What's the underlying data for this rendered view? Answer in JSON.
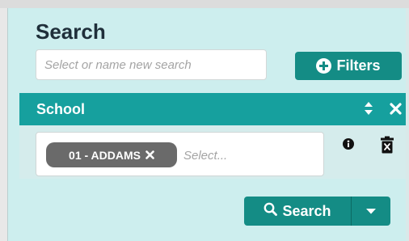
{
  "panel": {
    "title": "Search",
    "name_input": {
      "placeholder": "Select or name new search",
      "value": ""
    },
    "filters_button": {
      "label": "Filters",
      "icon": "plus-circle-icon"
    }
  },
  "filter": {
    "title": "School",
    "tags": [
      {
        "label": "01 - ADDAMS",
        "remove_icon": "times-icon"
      }
    ],
    "tag_input_placeholder": "Select...",
    "icons": [
      "sort-icon",
      "close-icon",
      "info-icon",
      "trash-icon"
    ]
  },
  "search_button": {
    "label": "Search",
    "icon": "search-icon",
    "dropdown_icon": "caret-down-icon"
  },
  "colors": {
    "panel_background": "#cdeeee",
    "accent": "#148c85",
    "filter_header": "#16a09e",
    "tag_background": "#6a6a6a"
  }
}
